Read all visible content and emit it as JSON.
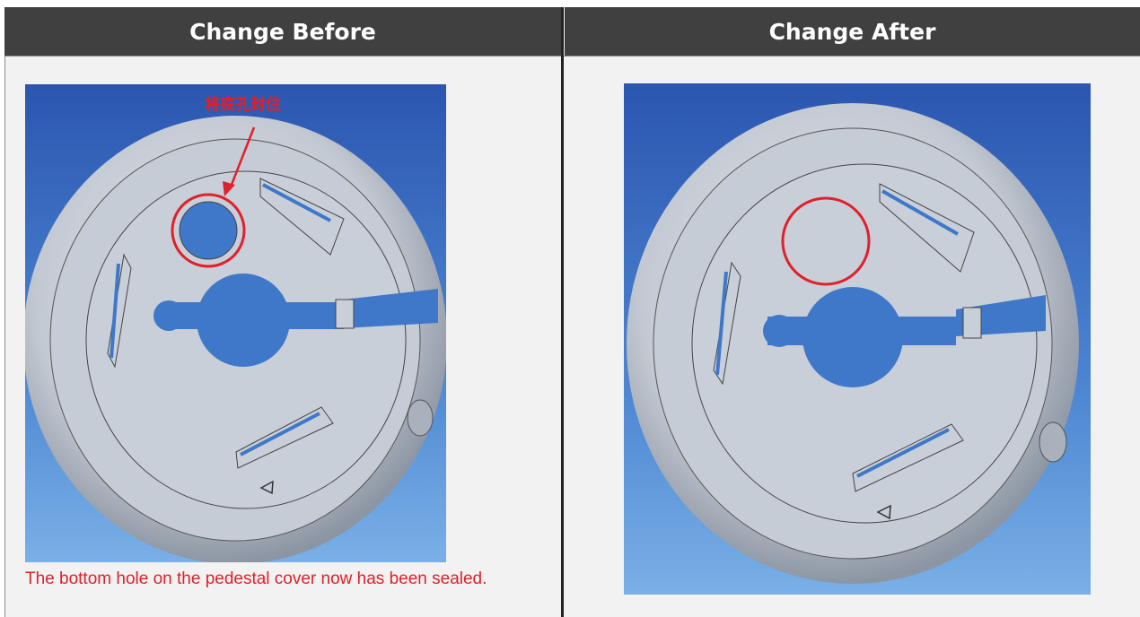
{
  "columns": {
    "before": {
      "title": "Change Before"
    },
    "after": {
      "title": "Change After"
    }
  },
  "annotation": {
    "label_cn": "将底孔封住"
  },
  "caption": "The bottom hole on the pedestal cover now has been sealed.",
  "colors": {
    "header_bg": "#404040",
    "annotation_red": "#e0202a",
    "background_blue": "#2f5fb8",
    "part_gray": "#c9ced6"
  }
}
